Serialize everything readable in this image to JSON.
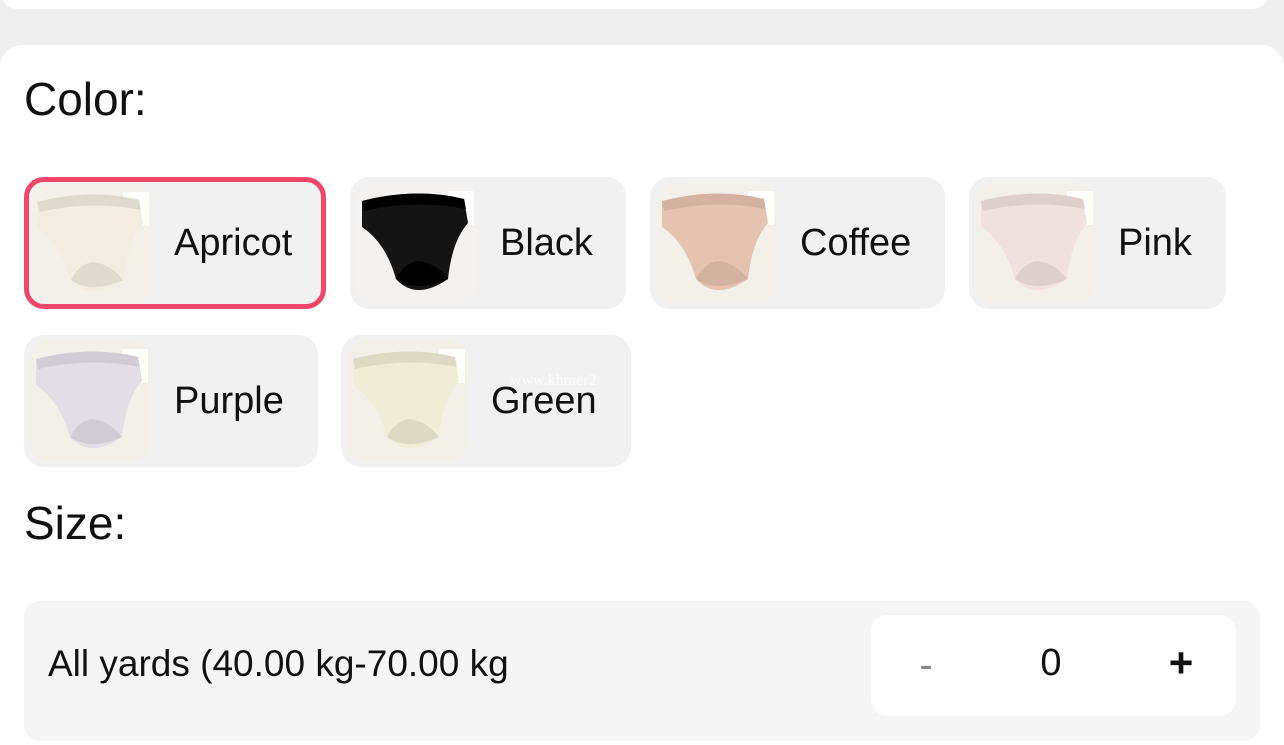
{
  "color_section": {
    "label": "Color:",
    "selected": "Apricot",
    "options": [
      {
        "name": "Apricot",
        "swatch": "#f2ede0",
        "icon": "apricot-product-thumbnail"
      },
      {
        "name": "Black",
        "swatch": "#141414",
        "icon": "black-product-thumbnail"
      },
      {
        "name": "Coffee",
        "swatch": "#e6c2b0",
        "icon": "coffee-product-thumbnail"
      },
      {
        "name": "Pink",
        "swatch": "#f1e1de",
        "icon": "pink-product-thumbnail"
      },
      {
        "name": "Purple",
        "swatch": "#e3dde6",
        "icon": "purple-product-thumbnail"
      },
      {
        "name": "Green",
        "swatch": "#efedd6",
        "icon": "green-product-thumbnail"
      }
    ]
  },
  "size_section": {
    "label": "Size:",
    "option_label": "All yards (40.00 kg-70.00 kg",
    "stepper": {
      "minus": "-",
      "quantity": "0",
      "plus": "+"
    }
  },
  "watermark": "www.khmer2",
  "colors": {
    "accent": "#f0466a",
    "chip_bg": "#f1f1f1",
    "page_bg": "#efefef"
  }
}
